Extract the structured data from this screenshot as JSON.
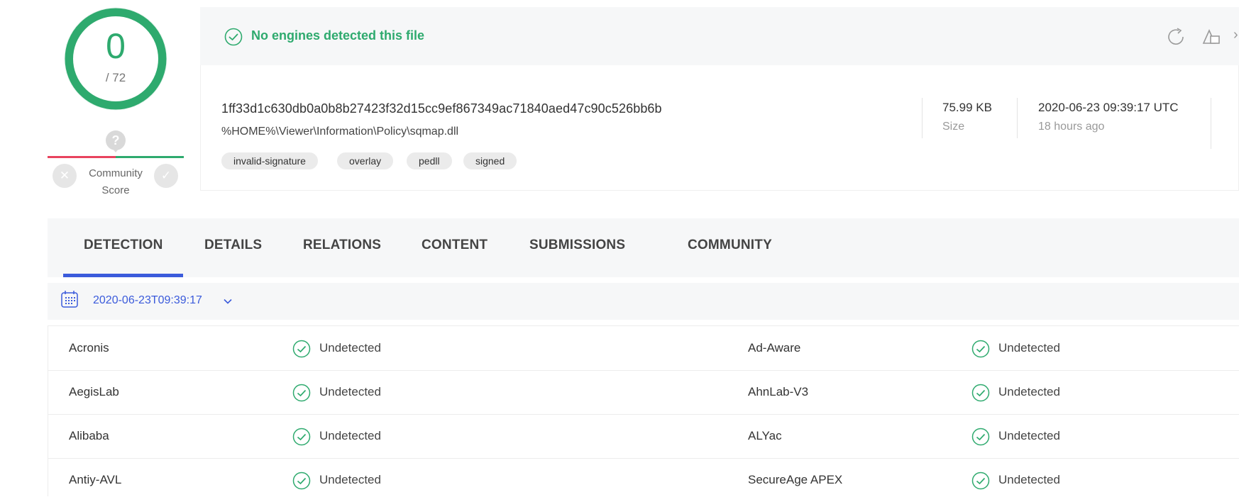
{
  "score": {
    "detected": "0",
    "total": "/ 72"
  },
  "community": {
    "question": "?",
    "label": "Community\nScore",
    "label_line1": "Community",
    "label_line2": "Score"
  },
  "summary": {
    "status": "No engines detected this file",
    "hash": "1ff33d1c630db0a0b8b27423f32d15cc9ef867349ac71840aed47c90c526bb6b",
    "path": "%HOME%\\Viewer\\Information\\Policy\\sqmap.dll",
    "tags": [
      "invalid-signature",
      "overlay",
      "pedll",
      "signed"
    ],
    "size_value": "75.99 KB",
    "size_label": "Size",
    "date_value": "2020-06-23 09:39:17 UTC",
    "date_ago": "18 hours ago"
  },
  "tabs": [
    "DETECTION",
    "DETAILS",
    "RELATIONS",
    "CONTENT",
    "SUBMISSIONS",
    "COMMUNITY"
  ],
  "active_tab": "DETECTION",
  "analysis_date": "2020-06-23T09:39:17",
  "detections": [
    {
      "left_engine": "Acronis",
      "left_result": "Undetected",
      "right_engine": "Ad-Aware",
      "right_result": "Undetected"
    },
    {
      "left_engine": "AegisLab",
      "left_result": "Undetected",
      "right_engine": "AhnLab-V3",
      "right_result": "Undetected"
    },
    {
      "left_engine": "Alibaba",
      "left_result": "Undetected",
      "right_engine": "ALYac",
      "right_result": "Undetected"
    },
    {
      "left_engine": "Antiy-AVL",
      "left_result": "Undetected",
      "right_engine": "SecureAge APEX",
      "right_result": "Undetected"
    }
  ],
  "icons": {
    "status": "check-circle-icon",
    "reanalyze": "reanalyze-icon",
    "similar": "similar-files-icon",
    "calendar": "calendar-icon",
    "chevron": "chevron-down-icon"
  },
  "colors": {
    "clean": "#2eaa6e",
    "malicious": "#e8435e",
    "accent": "#3b5bdb"
  }
}
